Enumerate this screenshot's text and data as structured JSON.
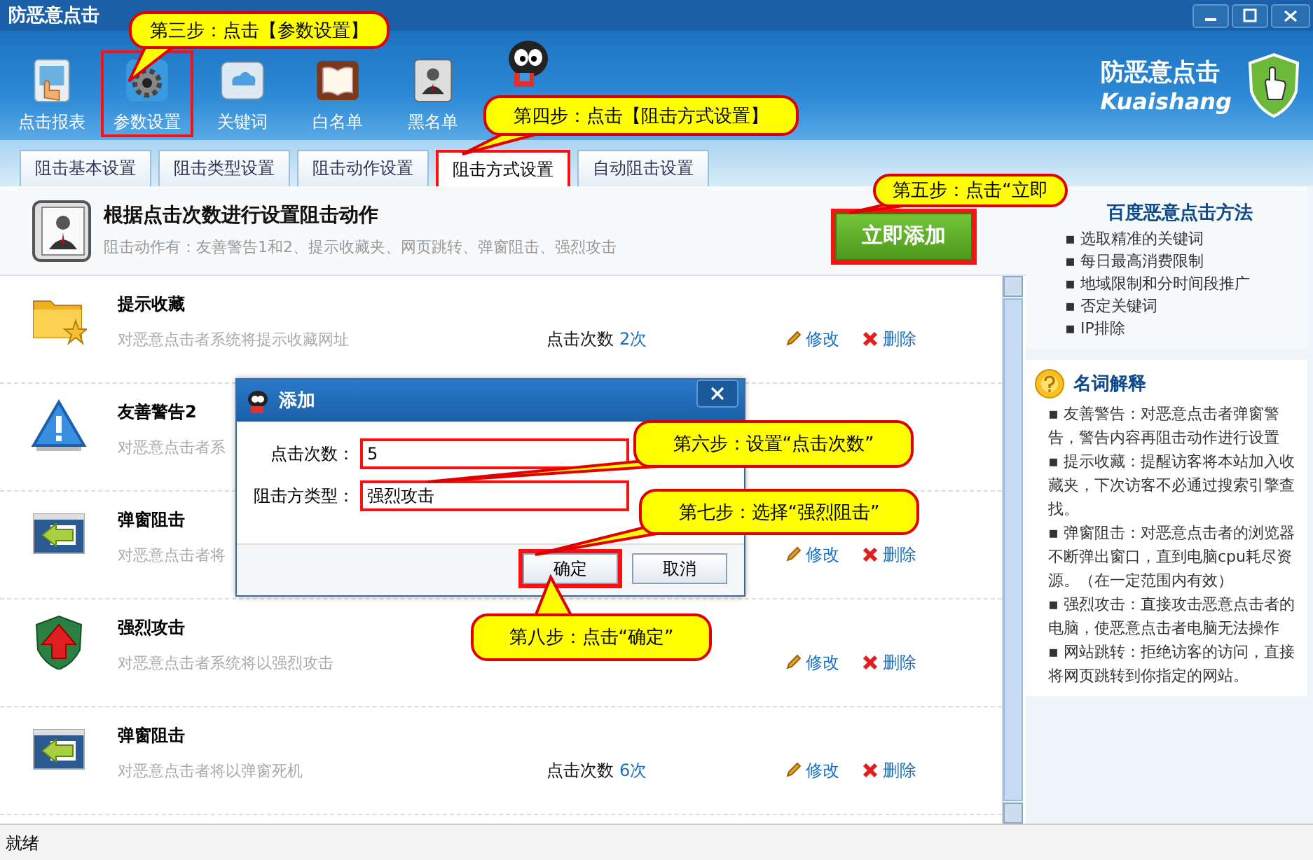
{
  "window": {
    "title": "防恶意点击"
  },
  "toolbar": [
    {
      "kind": "report",
      "label": "点击报表",
      "highlighted": false
    },
    {
      "kind": "settings",
      "label": "参数设置",
      "highlighted": true
    },
    {
      "kind": "cloud",
      "label": "关键词",
      "highlighted": false
    },
    {
      "kind": "book",
      "label": "白名单",
      "highlighted": false
    },
    {
      "kind": "contacts",
      "label": "黑名单",
      "highlighted": false
    },
    {
      "kind": "mascot"
    }
  ],
  "brand": {
    "name": "防恶意点击",
    "subname": "Kuaishang"
  },
  "tabs": [
    {
      "label": "阻击基本设置",
      "selected": false,
      "highlighted": false
    },
    {
      "label": "阻击类型设置",
      "selected": false,
      "highlighted": false
    },
    {
      "label": "阻击动作设置",
      "selected": false,
      "highlighted": false
    },
    {
      "label": "阻击方式设置",
      "selected": true,
      "highlighted": true
    },
    {
      "label": "自动阻击设置",
      "selected": false,
      "highlighted": false
    }
  ],
  "header": {
    "title": "根据点击次数进行设置阻击动作",
    "subtitle": "阻击动作有：友善警告1和2、提示收藏夹、网页跳转、弹窗阻击、强烈攻击",
    "add_button": {
      "label": "立即添加",
      "highlighted": true
    }
  },
  "actions": [
    {
      "kind": "favorite",
      "name": "提示收藏",
      "description": "对恶意点击者系统将提示收藏网址",
      "count_label": "点击次数",
      "count": "2次",
      "edit": "修改",
      "delete": "删除"
    },
    {
      "kind": "warning",
      "name": "友善警告2",
      "description": "对恶意点击者系"
    },
    {
      "kind": "popup",
      "name": "弹窗阻击",
      "description": "对恶意点击者将",
      "edit": "修改",
      "delete": "删除"
    },
    {
      "kind": "attack",
      "name": "强烈攻击",
      "description": "对恶意点击者系统将以强烈攻击",
      "edit": "修改",
      "delete": "删除"
    },
    {
      "kind": "popup",
      "name": "弹窗阻击",
      "description": "对恶意点击者将以弹窗死机",
      "count_label": "点击次数",
      "count": "6次",
      "edit": "修改",
      "delete": "删除"
    }
  ],
  "sidebar": {
    "methods": {
      "title": "百度恶意点击方法",
      "items": [
        "▪ 选取精准的关键词",
        "▪ 每日最高消费限制",
        "▪ 地域限制和分时间段推广",
        "▪ 否定关键词",
        "▪ IP排除"
      ]
    },
    "glossary": {
      "title": "名词解释",
      "items": [
        "▪ 友善警告：对恶意点击者弹窗警告，警告内容再阻击动作进行设置",
        "▪ 提示收藏：提醒访客将本站加入收藏夹，下次访客不必通过搜索引擎查找。",
        "▪ 弹窗阻击：对恶意点击者的浏览器不断弹出窗口，直到电脑cpu耗尽资源。（在一定范围内有效）",
        "▪ 强烈攻击：直接攻击恶意点击者的电脑，使恶意点击者电脑无法操作",
        "▪  网站跳转：拒绝访客的访问，直接将网页跳转到你指定的网站。"
      ]
    }
  },
  "dialog": {
    "title": "添加",
    "fields": [
      {
        "label": "点击次数：",
        "value": "5",
        "highlighted": true
      },
      {
        "label": "阻击方类型：",
        "value": "强烈攻击",
        "highlighted": true
      }
    ],
    "buttons": [
      {
        "label": "确定",
        "highlighted": true
      },
      {
        "label": "取消",
        "highlighted": false
      }
    ]
  },
  "callouts": [
    "第三步：点击【参数设置】",
    "第四步：点击【阻击方式设置】",
    "第五步：点击“立即",
    "第六步：设置“点击次数”",
    "第七步：选择“强烈阻击”",
    "第八步：点击“确定”"
  ],
  "status_bar": "就绪"
}
